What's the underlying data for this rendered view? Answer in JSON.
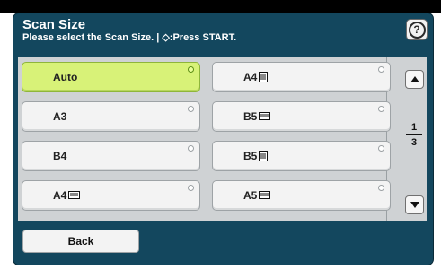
{
  "header": {
    "title": "Scan Size",
    "subtitle": "Please select the Scan Size. | ◇:Press START."
  },
  "help": {
    "label": "?"
  },
  "options": [
    {
      "label": "Auto",
      "orientation": "none",
      "selected": true
    },
    {
      "label": "A4",
      "orientation": "portrait-icon",
      "selected": false
    },
    {
      "label": "A3",
      "orientation": "none",
      "selected": false
    },
    {
      "label": "B5",
      "orientation": "landscape-icon",
      "selected": false
    },
    {
      "label": "B4",
      "orientation": "none",
      "selected": false
    },
    {
      "label": "B5",
      "orientation": "portrait-icon",
      "selected": false
    },
    {
      "label": "A4",
      "orientation": "landscape-icon",
      "selected": false
    },
    {
      "label": "A5",
      "orientation": "landscape-icon",
      "selected": false
    }
  ],
  "pagination": {
    "current": "1",
    "total": "3"
  },
  "footer": {
    "back_label": "Back"
  },
  "colors": {
    "panel": "#13475e",
    "selected": "#d8f278",
    "button": "#f3f3f3"
  }
}
